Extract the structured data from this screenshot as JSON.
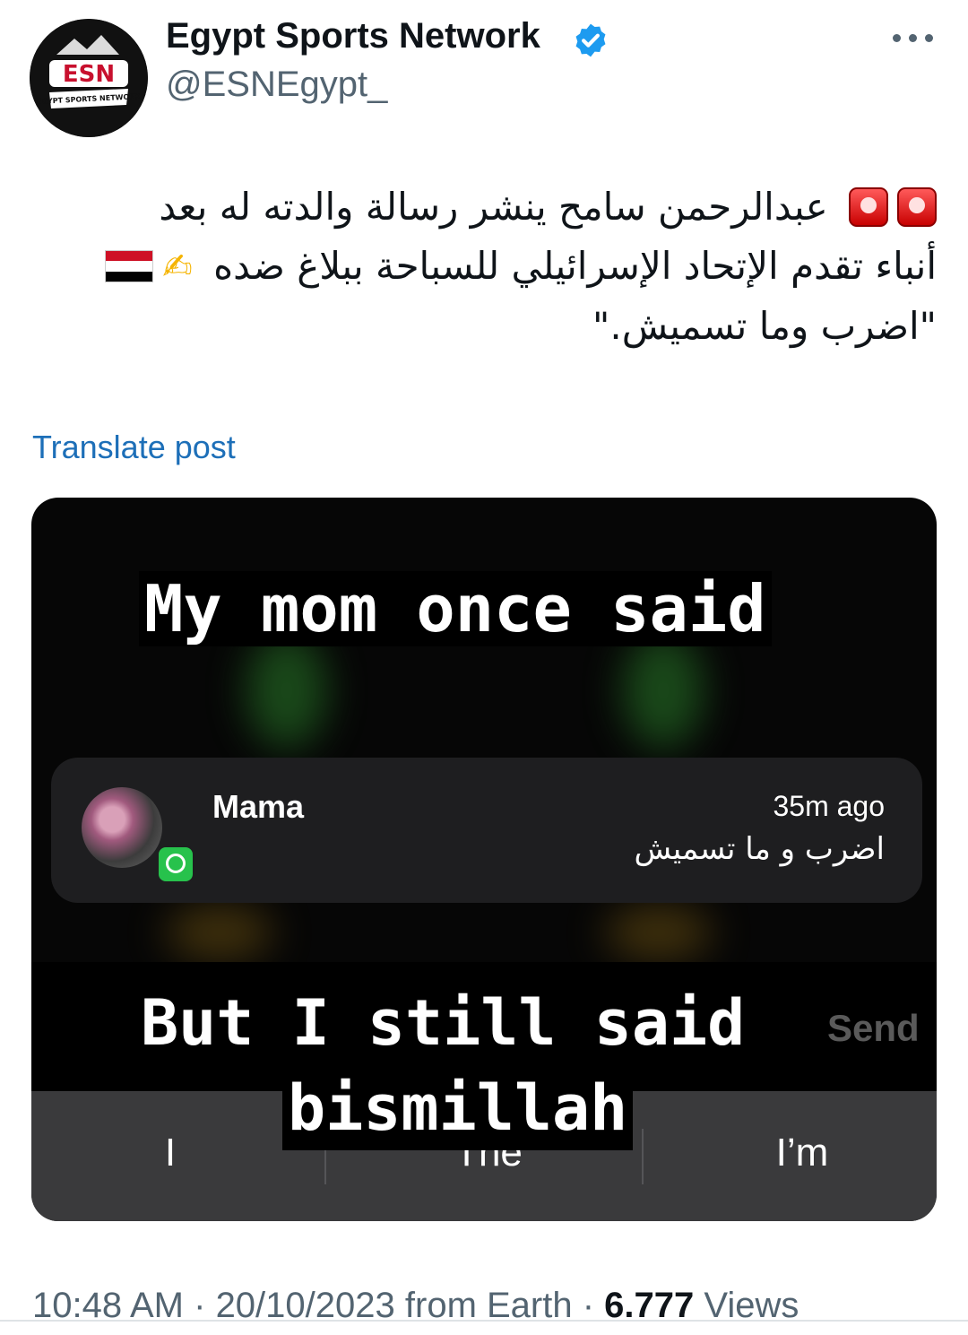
{
  "author": {
    "name": "Egypt Sports Network",
    "handle": "@ESNEgypt_",
    "avatar_logo_text": "ESN",
    "avatar_logo_subtext": "EGYPT SPORTS NETWORK",
    "verified_icon": "verified-badge-icon"
  },
  "post": {
    "line1": "عبدالرحمن سامح ينشر رسالة والدته له بعد",
    "line2": "أنباء تقدم الإتحاد الإسرائيلي للسباحة ببلاغ ضده",
    "line3": "\"اضرب وما تسميش.\"",
    "emojis": [
      "siren-emoji",
      "siren-emoji",
      "writing-hand-emoji",
      "egypt-flag-emoji"
    ],
    "translate_label": "Translate post"
  },
  "media": {
    "caption_top": "My mom once said",
    "notification": {
      "sender": "Mama",
      "time": "35m ago",
      "message": "اضرب و ما تسميش",
      "app_icon": "whatsapp-icon"
    },
    "caption_bottom_line1": "But I still said",
    "caption_bottom_line2": "bismillah",
    "send_label": "Send",
    "keyboard_suggestions": [
      "I",
      "The",
      "I’m"
    ]
  },
  "meta": {
    "time": "10:48 AM",
    "separator": " · ",
    "date": "20/10/2023",
    "source": "from Earth",
    "views_count": "6.777",
    "views_label": "Views"
  },
  "colors": {
    "verified_blue": "#1d9bf0",
    "link_blue": "#1d6fb8",
    "secondary_text": "#536471",
    "whatsapp_green": "#27c24c"
  }
}
